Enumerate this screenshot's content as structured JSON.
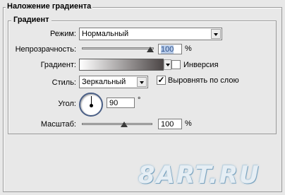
{
  "panel_title": "Наложение градиента",
  "group_title": "Градиент",
  "mode": {
    "label": "Режим:",
    "value": "Нормальный"
  },
  "opacity": {
    "label": "Непрозрачность:",
    "value": "100",
    "unit": "%",
    "level": 1.0
  },
  "gradient": {
    "label": "Градиент:",
    "start_color": "#ffffff",
    "end_color": "#4d4747"
  },
  "invert": {
    "label": "Инверсия",
    "checked": false
  },
  "style": {
    "label": "Стиль:",
    "value": "Зеркальный"
  },
  "align": {
    "label": "Выровнять по слою",
    "checked": true
  },
  "angle": {
    "label": "Угол:",
    "value": "90",
    "unit": "°"
  },
  "scale": {
    "label": "Масштаб:",
    "value": "100",
    "unit": "%",
    "level": 0.5
  },
  "watermark": "8ART.RU",
  "colors": {
    "panel_bg": "#e8e8e8",
    "selection": "#b7cbe8",
    "dial_ring": "#4a5f86"
  }
}
